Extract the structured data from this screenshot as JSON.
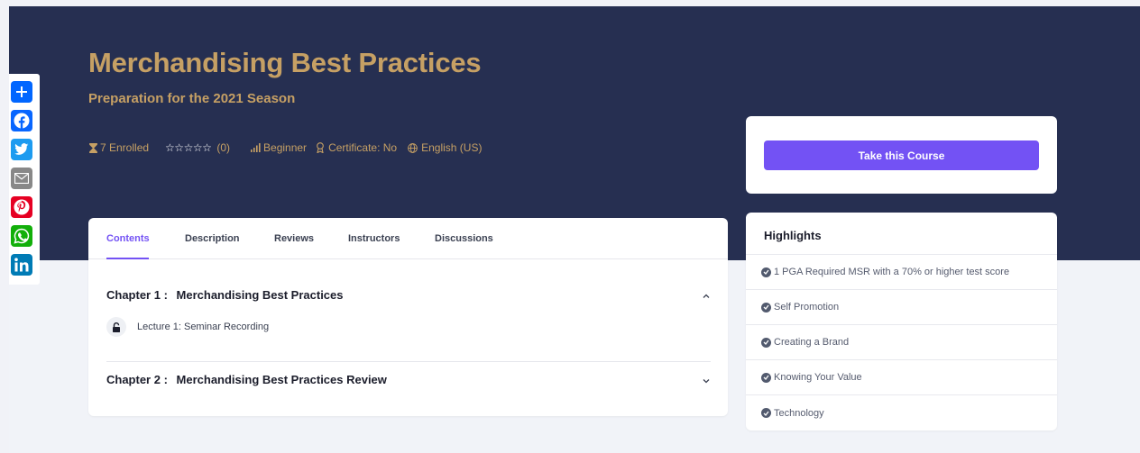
{
  "course": {
    "title": "Merchandising Best Practices",
    "subtitle": "Preparation for the 2021 Season"
  },
  "meta": {
    "enrolled": "7 Enrolled",
    "stars": "☆☆☆☆☆",
    "rating_count": "(0)",
    "level": "Beginner",
    "certificate": "Certificate: No",
    "language": "English (US)"
  },
  "share": [
    {
      "icon": "add-share-icon",
      "color": "#0166ff"
    },
    {
      "icon": "facebook-icon",
      "color": "#0866ff"
    },
    {
      "icon": "twitter-icon",
      "color": "#1d9bf0"
    },
    {
      "icon": "email-icon",
      "color": "#888888"
    },
    {
      "icon": "pinterest-icon",
      "color": "#e60023"
    },
    {
      "icon": "whatsapp-icon",
      "color": "#12af0a"
    },
    {
      "icon": "linkedin-icon",
      "color": "#007bb5"
    }
  ],
  "enroll": {
    "button_label": "Take this Course"
  },
  "tabs": [
    {
      "label": "Contents",
      "active": true
    },
    {
      "label": "Description",
      "active": false
    },
    {
      "label": "Reviews",
      "active": false
    },
    {
      "label": "Instructors",
      "active": false
    },
    {
      "label": "Discussions",
      "active": false
    }
  ],
  "chapters": [
    {
      "number": "Chapter 1 :",
      "title": "Merchandising Best Practices",
      "expanded": true,
      "lectures": [
        {
          "label": "Lecture 1: Seminar Recording",
          "locked": true
        }
      ]
    },
    {
      "number": "Chapter 2 :",
      "title": "Merchandising Best Practices Review",
      "expanded": false,
      "lectures": []
    }
  ],
  "highlights": {
    "heading": "Highlights",
    "items": [
      "1 PGA Required MSR with a 70% or higher test score",
      "Self Promotion",
      "Creating a Brand",
      "Knowing Your Value",
      "Technology"
    ]
  },
  "colors": {
    "hero_bg": "#262f51",
    "gold": "#c6a064",
    "accent": "#7352f4"
  }
}
